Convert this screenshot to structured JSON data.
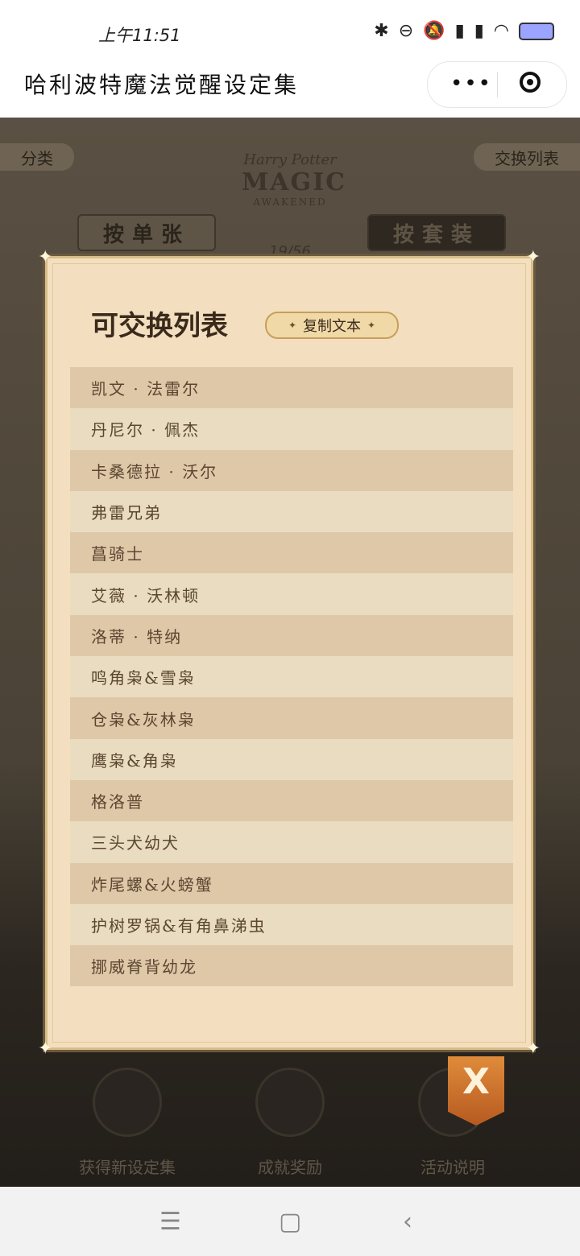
{
  "status": {
    "time": "上午11:51"
  },
  "nav": {
    "title": "哈利波特魔法觉醒设定集"
  },
  "bg": {
    "tag_left": "分类",
    "tag_right": "交换列表",
    "logo_line1": "Harry Potter",
    "logo_line2": "MAGIC",
    "logo_line3": "AWAKENED",
    "seg_single": "按单张",
    "seg_set": "按套装",
    "count": "19/56",
    "menu": [
      {
        "label": "获得新设定集"
      },
      {
        "label": "成就奖励"
      },
      {
        "label": "活动说明"
      }
    ]
  },
  "dialog": {
    "title": "可交换列表",
    "copy_label": "复制文本",
    "items": [
      "凯文 · 法雷尔",
      "丹尼尔 · 佩杰",
      "卡桑德拉 · 沃尔",
      "弗雷兄弟",
      "菖骑士",
      "艾薇 · 沃林顿",
      "洛蒂 · 特纳",
      "鸣角枭&雪枭",
      "仓枭&灰林枭",
      "鹰枭&角枭",
      "格洛普",
      "三头犬幼犬",
      "炸尾螺&火螃蟹",
      "护树罗锅&有角鼻涕虫",
      "挪威脊背幼龙"
    ],
    "close_label": "X"
  },
  "sysnav": {
    "menu": "☰",
    "home": "▢",
    "back": "‹"
  }
}
